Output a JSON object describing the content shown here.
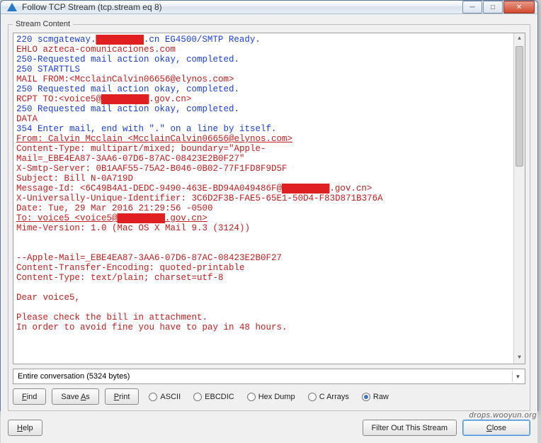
{
  "window": {
    "title": "Follow TCP Stream (tcp.stream eq 8)"
  },
  "fieldset_label": "Stream Content",
  "lines": [
    {
      "cls": "blue",
      "segs": [
        {
          "t": "220 scmgateway."
        },
        {
          "t": "▇▇▇▇▇▇▇",
          "cls": "redact"
        },
        {
          "t": ".cn EG4500/SMTP Ready."
        }
      ]
    },
    {
      "cls": "red",
      "segs": [
        {
          "t": "EHLO azteca-comunicaciones.com"
        }
      ]
    },
    {
      "cls": "blue",
      "segs": [
        {
          "t": "250-Requested mail action okay, completed."
        }
      ]
    },
    {
      "cls": "blue",
      "segs": [
        {
          "t": "250 STARTTLS"
        }
      ]
    },
    {
      "cls": "red",
      "segs": [
        {
          "t": "MAIL FROM:<McclainCalvin06656@elynos.com>"
        }
      ]
    },
    {
      "cls": "blue",
      "segs": [
        {
          "t": "250 Requested mail action okay, completed."
        }
      ]
    },
    {
      "cls": "red",
      "segs": [
        {
          "t": "RCPT TO:<voice5@"
        },
        {
          "t": "▇▇▇▇▇▇▇",
          "cls": "redact"
        },
        {
          "t": ".gov.cn>"
        }
      ]
    },
    {
      "cls": "blue",
      "segs": [
        {
          "t": "250 Requested mail action okay, completed."
        }
      ]
    },
    {
      "cls": "red",
      "segs": [
        {
          "t": "DATA"
        }
      ]
    },
    {
      "cls": "blue",
      "segs": [
        {
          "t": "354 Enter mail, end with \".\" on a line by itself."
        }
      ]
    },
    {
      "cls": "red underline",
      "segs": [
        {
          "t": "From: Calvin Mcclain <McclainCalvin06656@elynos.com>"
        }
      ]
    },
    {
      "cls": "red",
      "segs": [
        {
          "t": "Content-Type: multipart/mixed; boundary=\"Apple-"
        }
      ]
    },
    {
      "cls": "red",
      "segs": [
        {
          "t": "Mail=_EBE4EA87-3AA6-07D6-87AC-08423E2B0F27\""
        }
      ]
    },
    {
      "cls": "red",
      "segs": [
        {
          "t": "X-Smtp-Server: 0B1AAF55-75A2-B046-0B02-77F1FD8F9D5F"
        }
      ]
    },
    {
      "cls": "red",
      "segs": [
        {
          "t": "Subject: Bill N-0A719D"
        }
      ]
    },
    {
      "cls": "red",
      "segs": [
        {
          "t": "Message-Id: <6C49B4A1-DEDC-9490-463E-BD94A049486F@"
        },
        {
          "t": "▇▇▇▇▇▇▇",
          "cls": "redact"
        },
        {
          "t": ".gov.cn>"
        }
      ]
    },
    {
      "cls": "red",
      "segs": [
        {
          "t": "X-Universally-Unique-Identifier: 3C6D2F3B-FAE5-65E1-50D4-F83D871B376A"
        }
      ]
    },
    {
      "cls": "red",
      "segs": [
        {
          "t": "Date: Tue, 29 Mar 2016 21:29:56 -0500"
        }
      ]
    },
    {
      "cls": "red underline",
      "segs": [
        {
          "t": "To: voice5 <voice5@"
        },
        {
          "t": "▇▇▇▇▇▇▇",
          "cls": "redact"
        },
        {
          "t": ".gov.cn>"
        }
      ]
    },
    {
      "cls": "red",
      "segs": [
        {
          "t": "Mime-Version: 1.0 (Mac OS X Mail 9.3 (3124))"
        }
      ]
    },
    {
      "cls": "",
      "segs": [
        {
          "t": ""
        }
      ]
    },
    {
      "cls": "",
      "segs": [
        {
          "t": ""
        }
      ]
    },
    {
      "cls": "red",
      "segs": [
        {
          "t": "--Apple-Mail=_EBE4EA87-3AA6-07D6-87AC-08423E2B0F27"
        }
      ]
    },
    {
      "cls": "red",
      "segs": [
        {
          "t": "Content-Transfer-Encoding: quoted-printable"
        }
      ]
    },
    {
      "cls": "red",
      "segs": [
        {
          "t": "Content-Type: text/plain; charset=utf-8"
        }
      ]
    },
    {
      "cls": "",
      "segs": [
        {
          "t": ""
        }
      ]
    },
    {
      "cls": "red",
      "segs": [
        {
          "t": "Dear voice5,"
        }
      ]
    },
    {
      "cls": "",
      "segs": [
        {
          "t": ""
        }
      ]
    },
    {
      "cls": "red",
      "segs": [
        {
          "t": "Please check the bill in attachment."
        }
      ]
    },
    {
      "cls": "red",
      "segs": [
        {
          "t": "In order to avoid fine you have to pay in 48 hours."
        }
      ]
    }
  ],
  "conversation_label": "Entire conversation (5324 bytes)",
  "buttons": {
    "find": "Find",
    "saveas": "Save As",
    "print": "Print",
    "help": "Help",
    "filter": "Filter Out This Stream",
    "close": "Close"
  },
  "radios": [
    {
      "key": "ascii",
      "label": "ASCII",
      "selected": false
    },
    {
      "key": "ebcdic",
      "label": "EBCDIC",
      "selected": false
    },
    {
      "key": "hexdump",
      "label": "Hex Dump",
      "selected": false
    },
    {
      "key": "carrays",
      "label": "C Arrays",
      "selected": false
    },
    {
      "key": "raw",
      "label": "Raw",
      "selected": true
    }
  ],
  "watermark": "drops.wooyun.org"
}
